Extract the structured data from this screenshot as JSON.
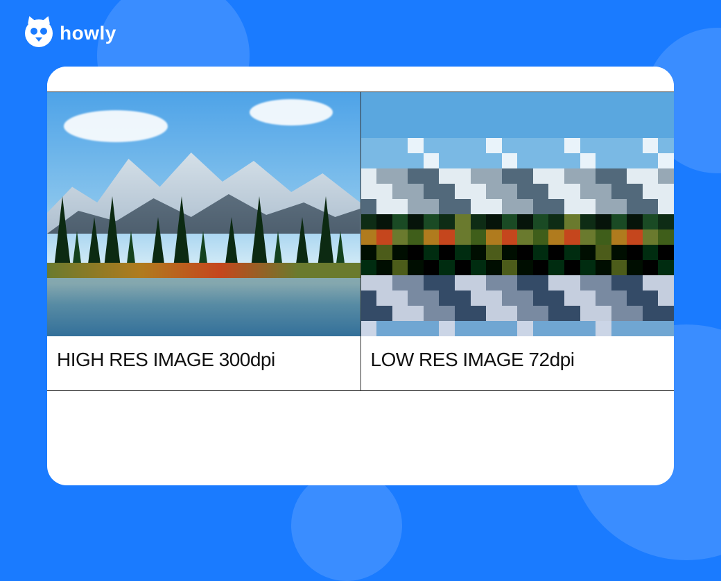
{
  "brand": {
    "name": "howly"
  },
  "comparison": {
    "left": {
      "caption": "HIGH RES IMAGE 300dpi"
    },
    "right": {
      "caption": "LOW RES IMAGE 72dpi"
    }
  }
}
